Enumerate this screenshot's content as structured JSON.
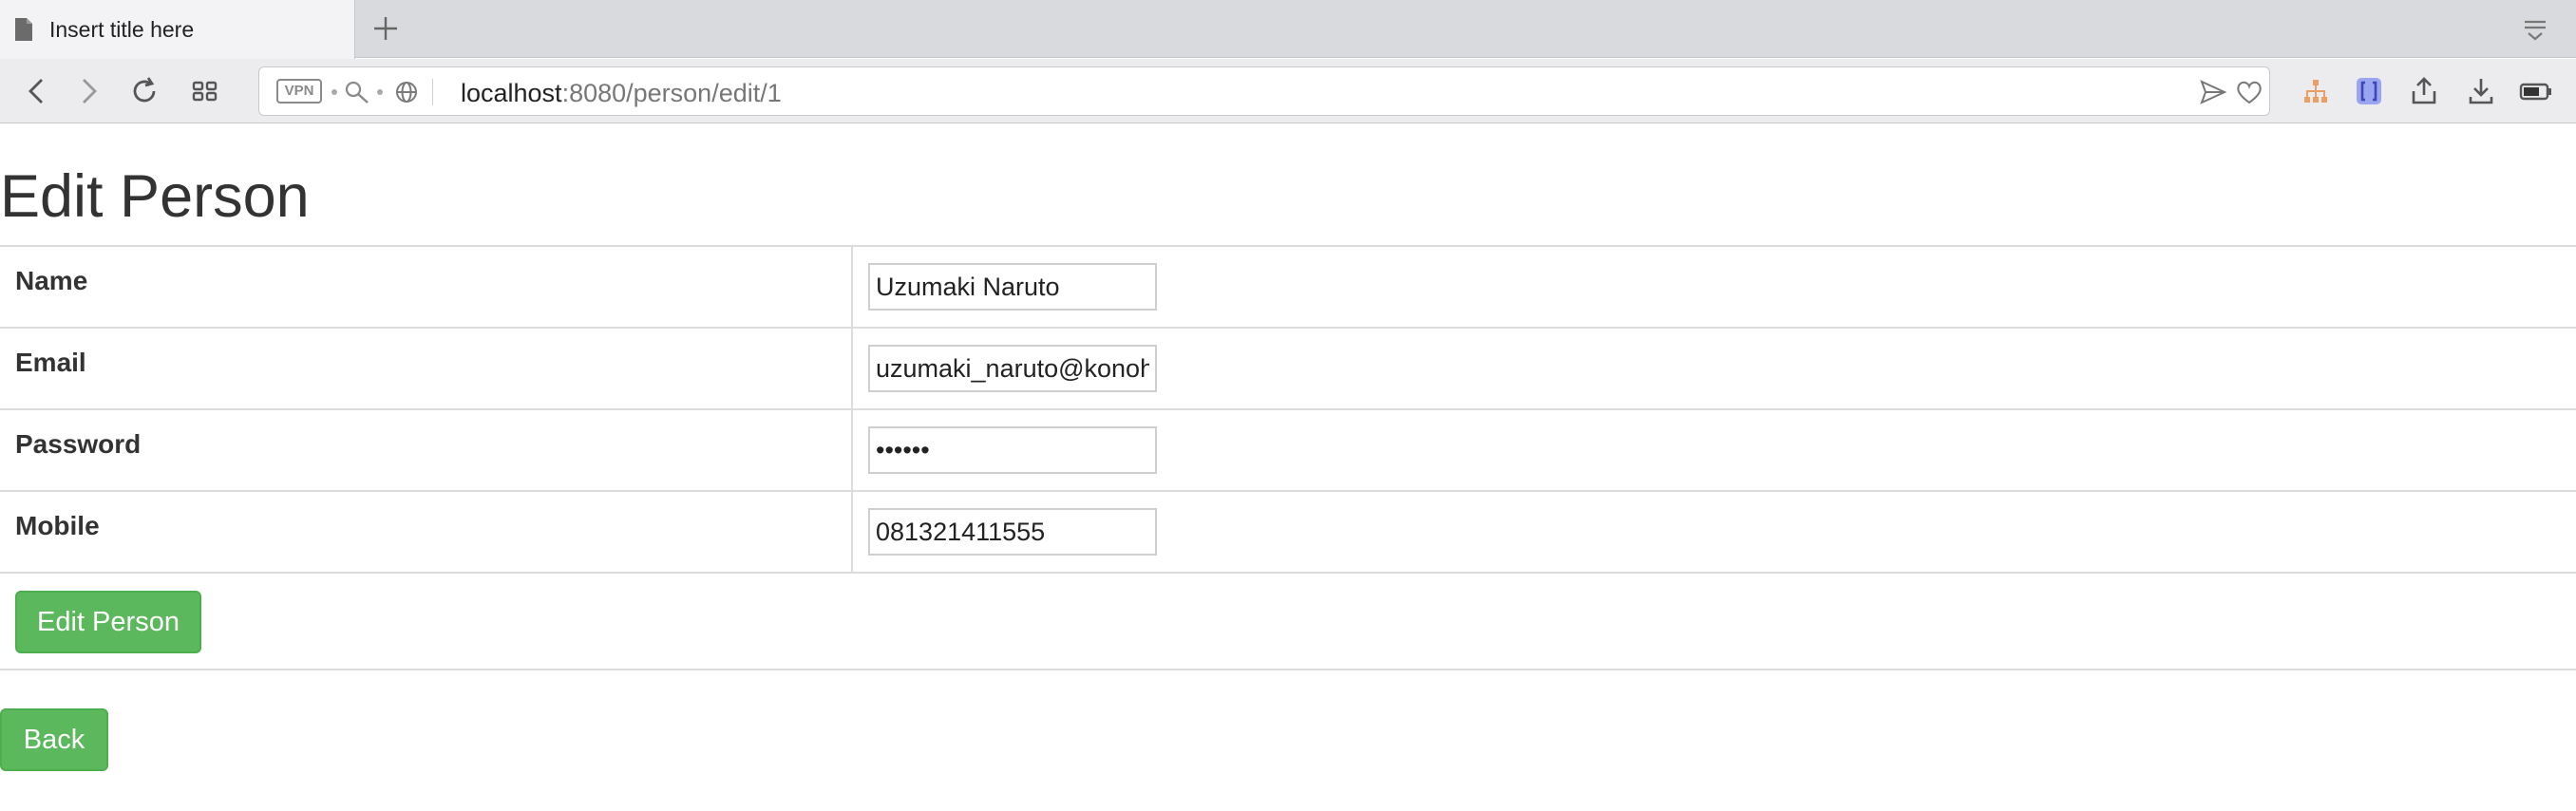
{
  "browser": {
    "tab_title": "Insert title here",
    "url_host": "localhost",
    "url_path": ":8080/person/edit/1",
    "vpn_label": "VPN"
  },
  "icons": {
    "tab": "document-icon",
    "new_tab": "plus-icon",
    "tab_menu": "tab-menu-icon",
    "back": "back-arrow-icon",
    "forward": "forward-arrow-icon",
    "reload": "reload-icon",
    "speed_dial": "grid-icon",
    "search": "key-search-icon",
    "globe": "globe-icon",
    "send": "send-icon",
    "bookmark": "heart-icon",
    "ext1": "sitemap-icon",
    "ext2": "bracket-extension-icon",
    "share": "share-icon",
    "download": "download-icon",
    "battery": "battery-icon"
  },
  "page": {
    "title": "Edit Person",
    "fields": [
      {
        "label": "Name",
        "value": "Uzumaki Naruto",
        "type": "text"
      },
      {
        "label": "Email",
        "value": "uzumaki_naruto@konoha.com",
        "type": "text"
      },
      {
        "label": "Password",
        "value": "123456",
        "type": "password"
      },
      {
        "label": "Mobile",
        "value": "081321411555",
        "type": "text"
      }
    ],
    "submit_label": "Edit Person",
    "back_label": "Back"
  },
  "colors": {
    "button_green": "#5cb85c",
    "button_border": "#4cae4c",
    "text": "#333333"
  }
}
